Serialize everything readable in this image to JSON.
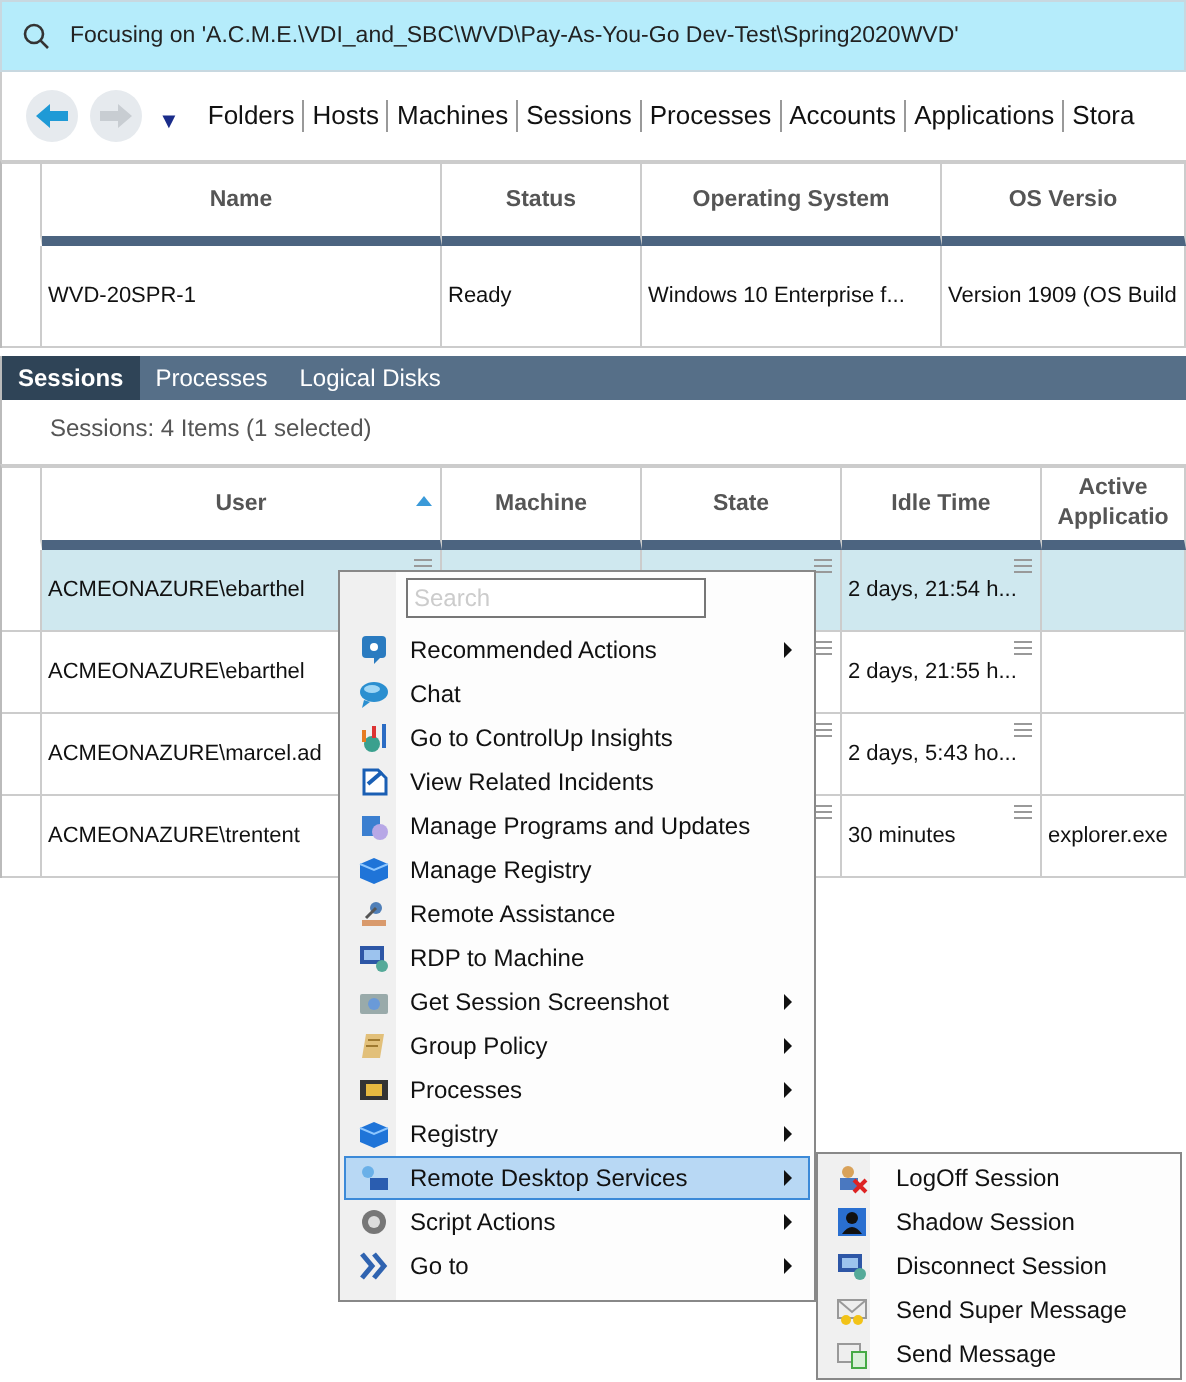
{
  "focus_bar": {
    "text": "Focusing on 'A.C.M.E.\\VDI_and_SBC\\WVD\\Pay-As-You-Go Dev-Test\\Spring2020WVD'"
  },
  "nav": {
    "menu_caret": "▼",
    "links": [
      "Folders",
      "Hosts",
      "Machines",
      "Sessions",
      "Processes",
      "Accounts",
      "Applications",
      "Stora"
    ]
  },
  "machines_table": {
    "columns": [
      "Name",
      "Status",
      "Operating System",
      "OS Versio"
    ],
    "rows": [
      {
        "cells": [
          "WVD-20SPR-1",
          "Ready",
          "Windows 10 Enterprise f...",
          "Version 1909 (OS Build"
        ],
        "selected": false
      }
    ]
  },
  "tabs": [
    {
      "label": "Sessions",
      "selected": true
    },
    {
      "label": "Processes",
      "selected": false
    },
    {
      "label": "Logical Disks",
      "selected": false
    }
  ],
  "sessions_summary": "Sessions: 4 Items (1 selected)",
  "sessions_table": {
    "columns": [
      {
        "label": "User",
        "sorted": true
      },
      {
        "label": "Machine",
        "sorted": false
      },
      {
        "label": "State",
        "sorted": false
      },
      {
        "label": "Idle Time",
        "sorted": false
      },
      {
        "label": "Active Applicatio",
        "sorted": false
      }
    ],
    "rows": [
      {
        "cells": [
          "ACMEONAZURE\\ebarthel",
          "",
          "",
          "2 days, 21:54 h...",
          ""
        ],
        "selected": true
      },
      {
        "cells": [
          "ACMEONAZURE\\ebarthel",
          "",
          "",
          "2 days, 21:55 h...",
          ""
        ],
        "selected": false
      },
      {
        "cells": [
          "ACMEONAZURE\\marcel.ad",
          "",
          "",
          "2 days, 5:43 ho...",
          ""
        ],
        "selected": false
      },
      {
        "cells": [
          "ACMEONAZURE\\trentent",
          "",
          "",
          "30 minutes",
          "explorer.exe"
        ],
        "selected": false
      }
    ]
  },
  "context_menu": {
    "search": {
      "placeholder": "Search"
    },
    "items": [
      {
        "label": "Recommended Actions",
        "submenu": true,
        "selected": false
      },
      {
        "label": "Chat",
        "submenu": false,
        "selected": false
      },
      {
        "label": "Go to ControlUp Insights",
        "submenu": false,
        "selected": false
      },
      {
        "label": "View Related Incidents",
        "submenu": false,
        "selected": false
      },
      {
        "label": "Manage Programs and Updates",
        "submenu": false,
        "selected": false
      },
      {
        "label": "Manage Registry",
        "submenu": false,
        "selected": false
      },
      {
        "label": "Remote Assistance",
        "submenu": false,
        "selected": false
      },
      {
        "label": "RDP to Machine",
        "submenu": false,
        "selected": false
      },
      {
        "label": "Get Session Screenshot",
        "submenu": true,
        "selected": false
      },
      {
        "label": "Group Policy",
        "submenu": true,
        "selected": false
      },
      {
        "label": "Processes",
        "submenu": true,
        "selected": false
      },
      {
        "label": "Registry",
        "submenu": true,
        "selected": false
      },
      {
        "label": "Remote Desktop Services",
        "submenu": true,
        "selected": true
      },
      {
        "label": "Script Actions",
        "submenu": true,
        "selected": false
      },
      {
        "label": "Go to",
        "submenu": true,
        "selected": false
      }
    ]
  },
  "submenu": {
    "items": [
      "LogOff Session",
      "Shadow Session",
      "Disconnect Session",
      "Send Super Message",
      "Send Message"
    ]
  }
}
